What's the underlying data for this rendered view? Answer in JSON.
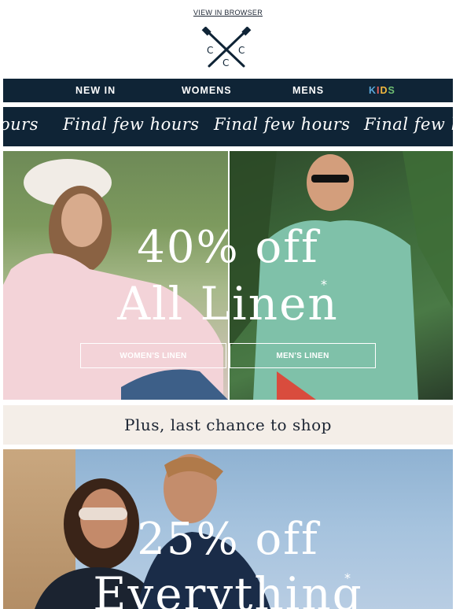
{
  "header": {
    "view_in_browser": "VIEW IN BROWSER"
  },
  "brand": {
    "logo_letters": [
      "C",
      "C",
      "C"
    ]
  },
  "nav": {
    "items": [
      "NEW IN",
      "WOMENS",
      "MENS",
      "KIDS"
    ]
  },
  "banner": {
    "text": "Final few hours",
    "repeat_text": [
      "ours",
      "Final few hours",
      "Final few hours",
      "Final few h"
    ]
  },
  "hero": {
    "title_line1": "40% off",
    "title_line2": "All Linen",
    "asterisk": "*",
    "buttons": [
      "WOMEN'S LINEN",
      "MEN'S LINEN"
    ]
  },
  "strip": {
    "text": "Plus, last chance to shop"
  },
  "hero2": {
    "title_line1": "25% off",
    "title_line2": "Everything",
    "asterisk": "*"
  },
  "colors": {
    "navy": "#0f2436",
    "cream": "#f4eee8",
    "kids_k": "#5aa6d8",
    "kids_i": "#e8625c",
    "kids_d": "#f0b63e",
    "kids_s": "#6fbf73"
  }
}
